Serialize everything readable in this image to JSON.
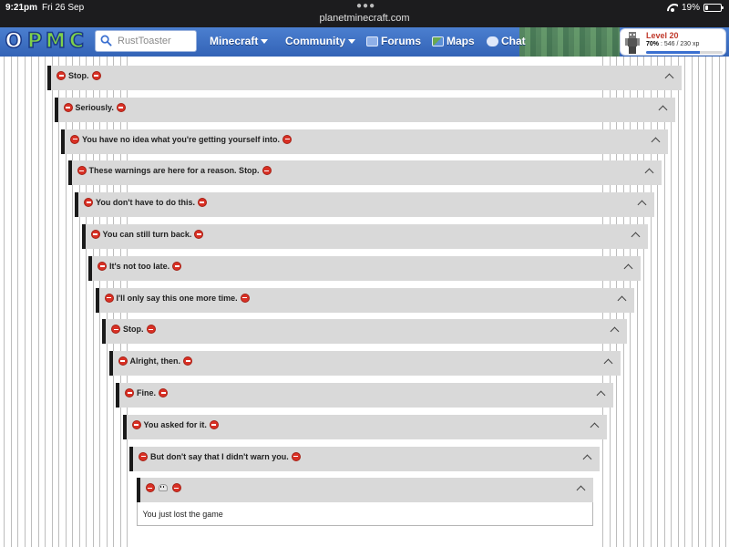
{
  "status_bar": {
    "time": "9:21pm",
    "date": "Fri 26 Sep",
    "url": "planetminecraft.com",
    "battery_level": "19%"
  },
  "header": {
    "logo_letters": [
      "O",
      "P",
      "M",
      "C"
    ],
    "search_placeholder": "RustToaster",
    "nav": [
      {
        "label": "Minecraft",
        "dropdown": true
      },
      {
        "label": "Community",
        "dropdown": true
      },
      {
        "label": "Forums",
        "icon": "forums-icon"
      },
      {
        "label": "Maps",
        "icon": "maps-icon"
      },
      {
        "label": "Chat",
        "icon": "chat-icon"
      }
    ],
    "xp": {
      "level": "Level 20",
      "percent_label": "70%",
      "progress_text": "546 / 230 xp",
      "progress_fraction": 0.7
    }
  },
  "spoilers": [
    {
      "title": "Stop."
    },
    {
      "title": "Seriously."
    },
    {
      "title": "You have no idea what you're getting yourself into."
    },
    {
      "title": "These warnings are here for a reason. Stop."
    },
    {
      "title": "You don't have to do this."
    },
    {
      "title": "You can still turn back."
    },
    {
      "title": "It's not too late."
    },
    {
      "title": "I'll only say this one more time."
    },
    {
      "title": "Stop."
    },
    {
      "title": "Alright, then."
    },
    {
      "title": "Fine."
    },
    {
      "title": "You asked for it."
    },
    {
      "title": "But don't say that I didn't warn you."
    },
    {
      "title": "",
      "skull": true
    }
  ],
  "final_body": "You just lost the game"
}
